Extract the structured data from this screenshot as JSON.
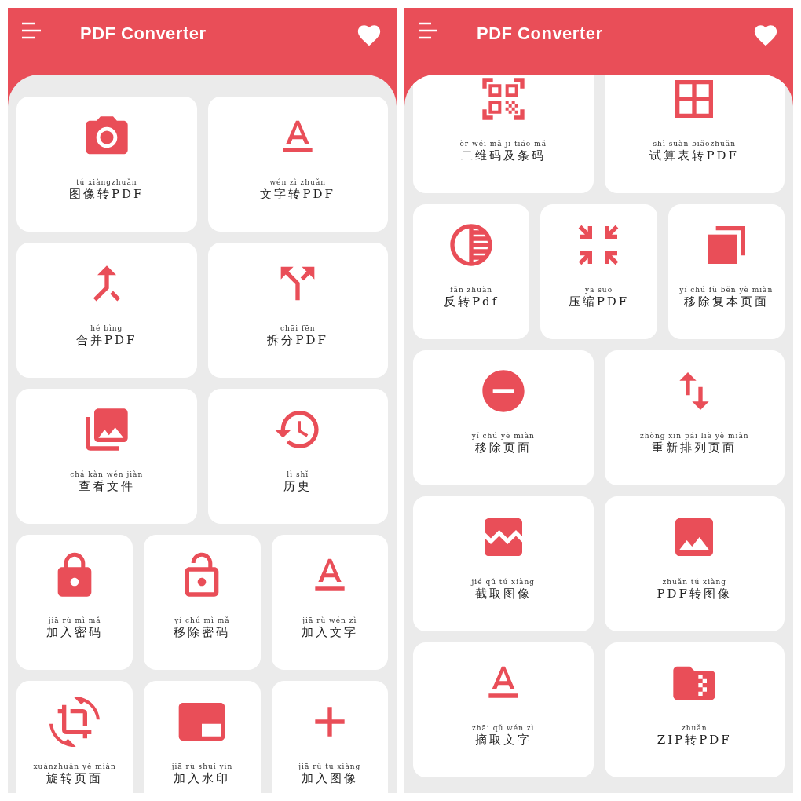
{
  "screens": [
    {
      "title": "PDF Converter",
      "rows": [
        {
          "tiles": [
            {
              "pinyin": "tú xiàngzhuǎn",
              "label": "图像转PDF"
            },
            {
              "pinyin": "wén zì zhuǎn",
              "label": "文字转PDF"
            }
          ]
        },
        {
          "tiles": [
            {
              "pinyin": "hé bìng",
              "label": "合并PDF"
            },
            {
              "pinyin": "chāi fēn",
              "label": "拆分PDF"
            }
          ]
        },
        {
          "tiles": [
            {
              "pinyin": "chá kàn wén jiàn",
              "label": "查看文件"
            },
            {
              "pinyin": "lì shǐ",
              "label": "历史"
            }
          ]
        },
        {
          "tiles": [
            {
              "pinyin": "jiā rù mì mǎ",
              "label": "加入密码"
            },
            {
              "pinyin": "yí chú mì mǎ",
              "label": "移除密码"
            },
            {
              "pinyin": "jiā rù wén zì",
              "label": "加入文字"
            }
          ]
        },
        {
          "tiles": [
            {
              "pinyin": "xuánzhuǎn yè miàn",
              "label": "旋转页面"
            },
            {
              "pinyin": "jiā rù shuǐ yìn",
              "label": "加入水印"
            },
            {
              "pinyin": "jiā rù tú xiàng",
              "label": "加入图像"
            }
          ]
        }
      ]
    },
    {
      "title": "PDF Converter",
      "rows": [
        {
          "tiles": [
            {
              "pinyin": "èr wéi mǎ jí tiáo mǎ",
              "label": "二维码及条码"
            },
            {
              "pinyin": "shì suàn biǎozhuǎn",
              "label": "试算表转PDF"
            }
          ]
        },
        {
          "tiles": [
            {
              "pinyin": "fǎn zhuǎn",
              "label": "反转Pdf"
            },
            {
              "pinyin": "yā suō",
              "label": "压缩PDF"
            },
            {
              "pinyin": "yí chú fù běn yè miàn",
              "label": "移除复本页面"
            }
          ]
        },
        {
          "tiles": [
            {
              "pinyin": "yí chú yè miàn",
              "label": "移除页面"
            },
            {
              "pinyin": "zhòng xīn pái liè yè miàn",
              "label": "重新排列页面"
            }
          ]
        },
        {
          "tiles": [
            {
              "pinyin": "jié qǔ tú xiàng",
              "label": "截取图像"
            },
            {
              "pinyin": "zhuǎn tú xiàng",
              "label": "PDF转图像"
            }
          ]
        },
        {
          "tiles": [
            {
              "pinyin": "zhāi qǔ wén zì",
              "label": "摘取文字"
            },
            {
              "pinyin": "zhuǎn",
              "label": "ZIP转PDF"
            }
          ]
        }
      ]
    }
  ]
}
